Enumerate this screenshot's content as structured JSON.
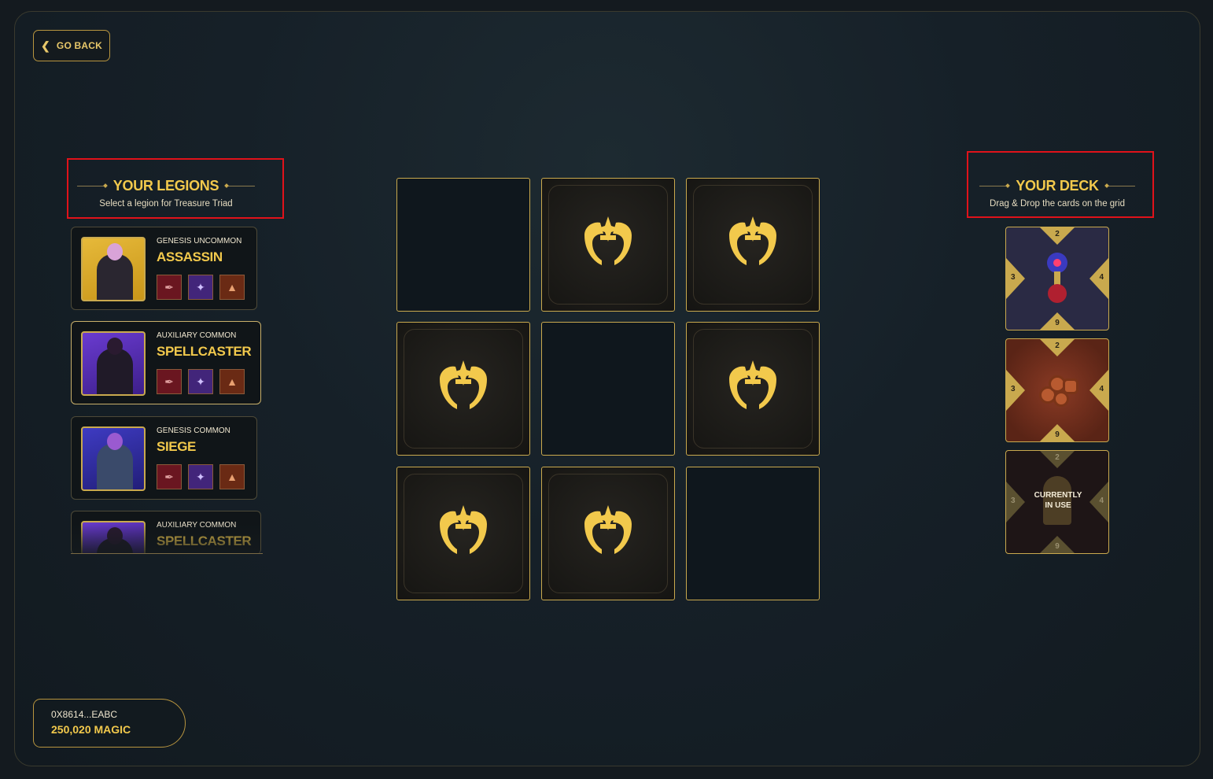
{
  "nav": {
    "back_label": "GO BACK"
  },
  "legions_panel": {
    "title": "YOUR LEGIONS",
    "subtitle": "Select a legion for Treasure Triad",
    "items": [
      {
        "type": "GENESIS UNCOMMON",
        "name": "ASSASSIN",
        "portrait_color": "gold",
        "selected": false
      },
      {
        "type": "AUXILIARY COMMON",
        "name": "SPELLCASTER",
        "portrait_color": "purple",
        "selected": true
      },
      {
        "type": "GENESIS COMMON",
        "name": "SIEGE",
        "portrait_color": "blue",
        "selected": false
      },
      {
        "type": "AUXILIARY COMMON",
        "name": "SPELLCASTER",
        "portrait_color": "purple",
        "selected": false
      }
    ],
    "item_icons": [
      "quill-icon",
      "crystal-icon",
      "ore-icon"
    ]
  },
  "board": {
    "cells": [
      "empty",
      "filled",
      "filled",
      "filled",
      "empty",
      "filled",
      "filled",
      "filled",
      "empty"
    ]
  },
  "deck_panel": {
    "title": "YOUR DECK",
    "subtitle": "Drag & Drop the cards on the grid",
    "cards": [
      {
        "top": "2",
        "left": "3",
        "right": "4",
        "bottom": "9",
        "art": "totem-icon",
        "in_use": false
      },
      {
        "top": "2",
        "left": "3",
        "right": "4",
        "bottom": "9",
        "art": "logs-icon",
        "in_use": false
      },
      {
        "top": "2",
        "left": "3",
        "right": "4",
        "bottom": "9",
        "art": "gnome-icon",
        "in_use": true,
        "in_use_label": "CURRENTLY IN USE"
      }
    ]
  },
  "wallet": {
    "address": "0X8614...EABC",
    "balance": "250,020 MAGIC"
  },
  "colors": {
    "accent": "#f2c94c",
    "border_gold": "#c9a94e",
    "highlight": "#e0121a",
    "background": "#141a1f"
  }
}
